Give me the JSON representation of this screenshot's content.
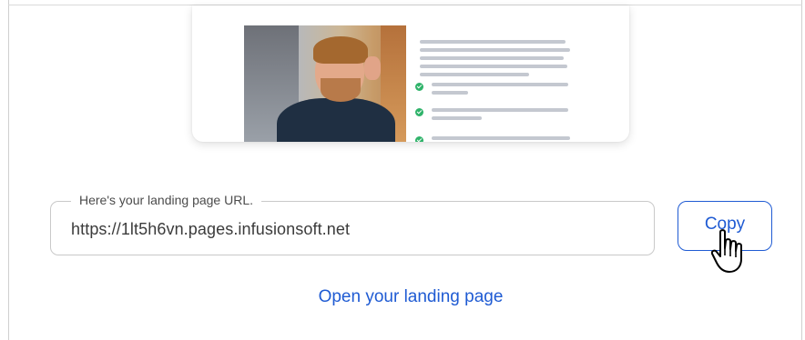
{
  "url_field": {
    "legend": "Here's your landing page URL.",
    "value": "https://1lt5h6vn.pages.infusionsoft.net"
  },
  "copy_button": {
    "label": "Copy"
  },
  "open_link": {
    "label": "Open your landing page"
  },
  "colors": {
    "accent": "#1f5bd3",
    "check": "#2fb36a"
  },
  "icons": {
    "cursor": "hand-pointer-icon",
    "check": "check-circle-icon"
  }
}
